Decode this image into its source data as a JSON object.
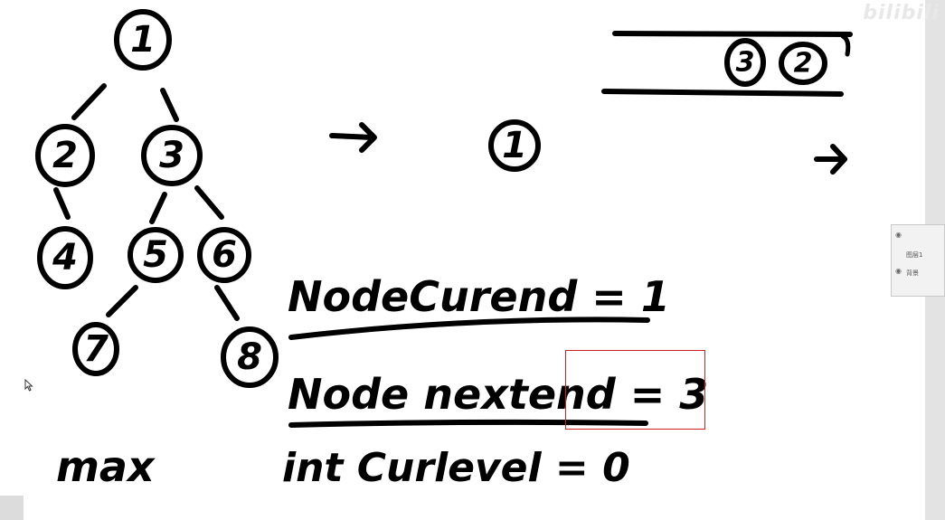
{
  "tree": {
    "nodes": [
      "1",
      "2",
      "3",
      "4",
      "5",
      "6",
      "7",
      "8"
    ]
  },
  "queue": {
    "items": [
      "3",
      "2"
    ]
  },
  "current_node": "1",
  "code": {
    "line1": "NodeCurend = 1",
    "line2": "Node nextend = 3",
    "line3": "int Curlevel = 0",
    "max_label": "max"
  },
  "watermark": "bilibili",
  "layers_panel": {
    "layer1_name": "图层1",
    "layer2_name": "背景"
  },
  "colors": {
    "ink": "#000000",
    "selection": "#d32020",
    "background": "#ffffff"
  }
}
